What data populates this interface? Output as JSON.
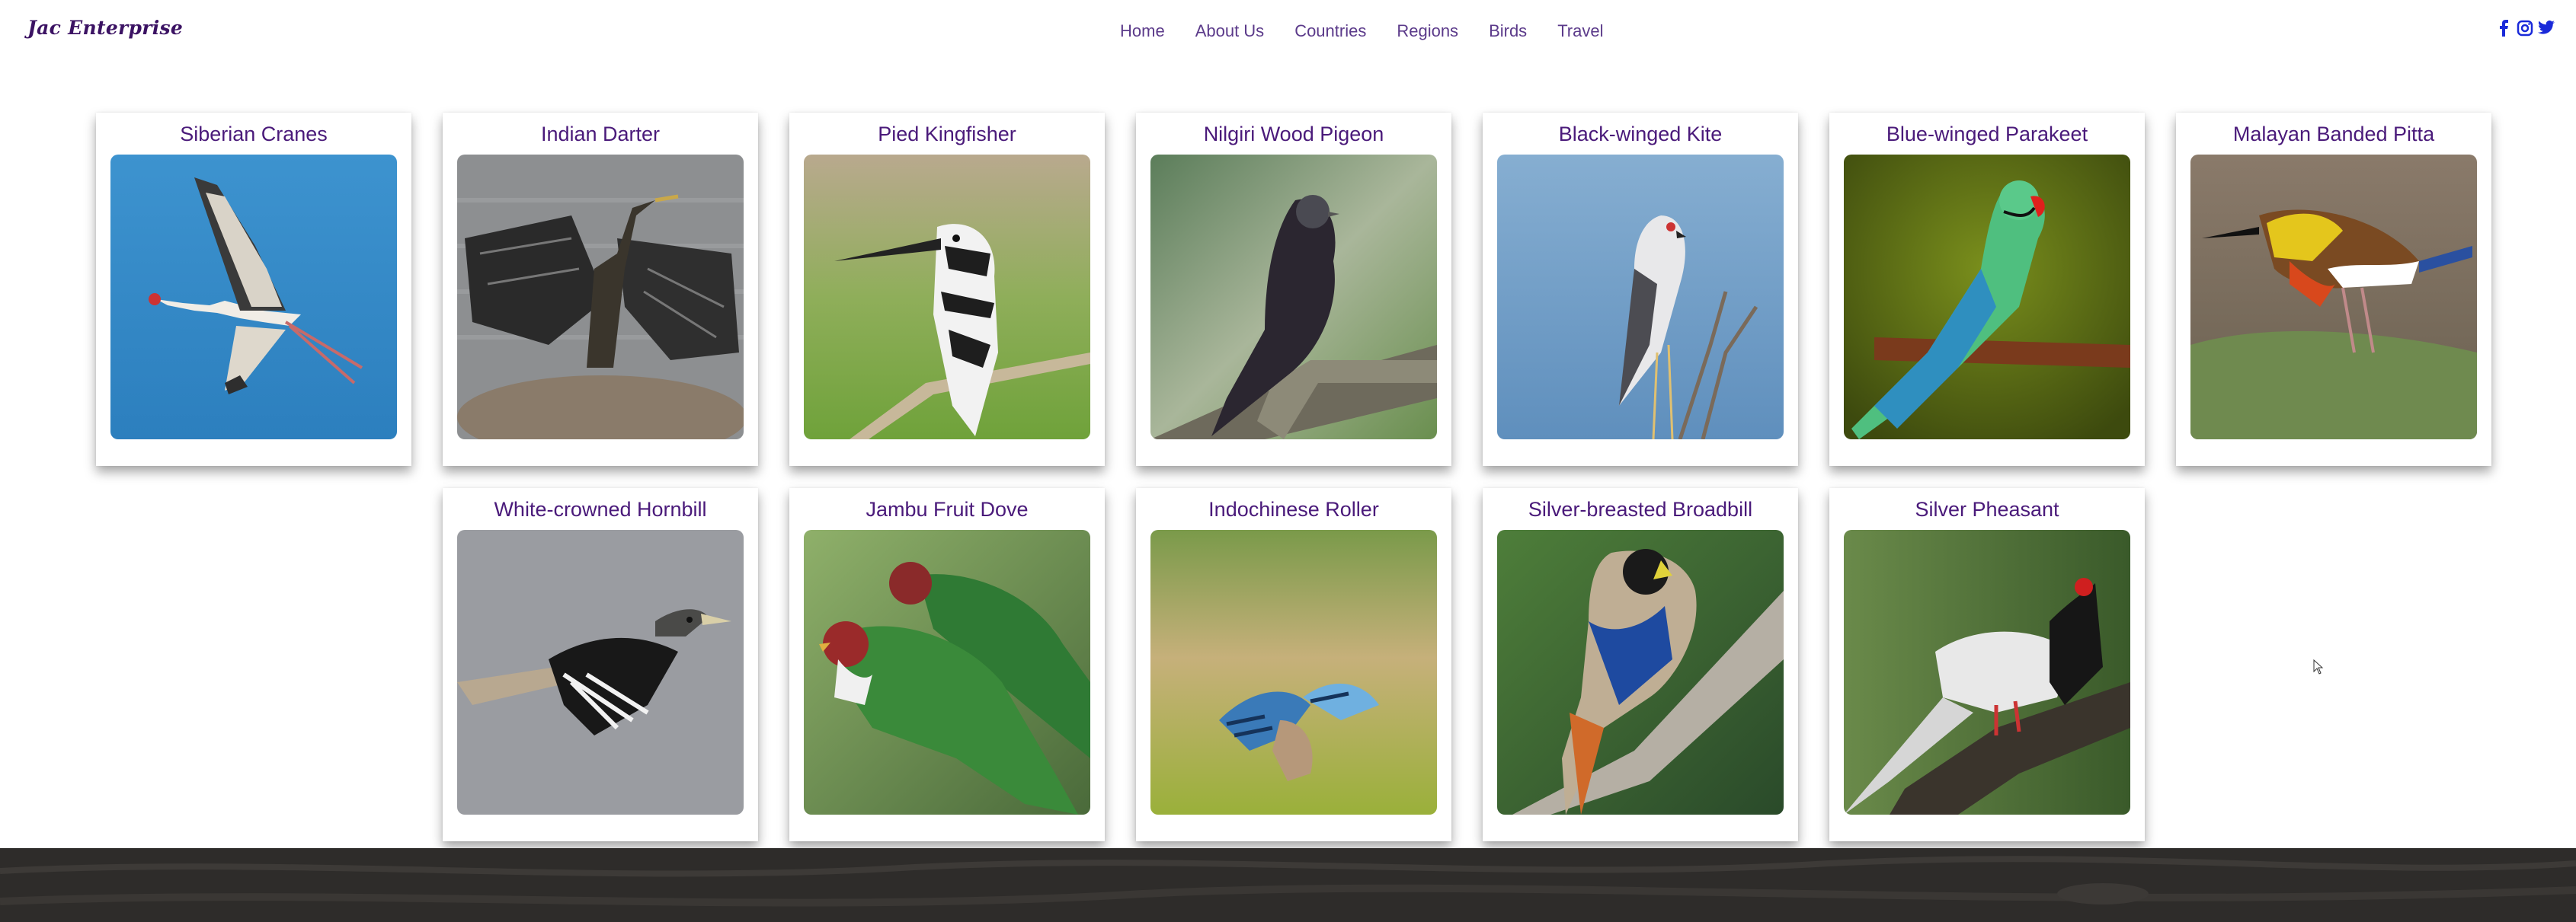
{
  "header": {
    "logo": "Jac Enterprise",
    "nav": [
      "Home",
      "About Us",
      "Countries",
      "Regions",
      "Birds",
      "Travel"
    ],
    "social_icons": [
      "facebook-icon",
      "instagram-icon",
      "twitter-icon"
    ]
  },
  "birds": [
    {
      "name": "Siberian Cranes"
    },
    {
      "name": "Indian Darter"
    },
    {
      "name": "Pied Kingfisher"
    },
    {
      "name": "Nilgiri Wood Pigeon"
    },
    {
      "name": "Black-winged Kite"
    },
    {
      "name": "Blue-winged Parakeet"
    },
    {
      "name": "Malayan Banded Pitta"
    },
    {
      "name": "White-crowned Hornbill"
    },
    {
      "name": "Jambu Fruit Dove"
    },
    {
      "name": "Indochinese Roller"
    },
    {
      "name": "Silver-breasted Broadbill"
    },
    {
      "name": "Silver Pheasant"
    }
  ],
  "colors": {
    "logo": "#3b1263",
    "nav_text": "#5b3a8a",
    "card_title": "#4a1a7a",
    "social_icon": "#1a2ad9",
    "footer": "#2e2c2a"
  }
}
